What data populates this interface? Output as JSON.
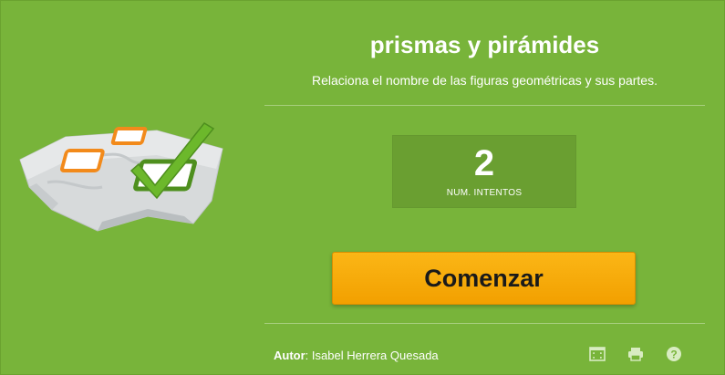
{
  "header": {
    "title": "prismas y pirámides",
    "subtitle": "Relaciona el nombre de las figuras geométricas y sus partes."
  },
  "attempts": {
    "value": "2",
    "label": "NUM. INTENTOS"
  },
  "start_button": {
    "label": "Comenzar"
  },
  "footer": {
    "author_label": "Autor",
    "author_separator": ":",
    "author_name": " Isabel Herrera Quesada",
    "icons": [
      "fullscreen-icon",
      "print-icon",
      "help-icon"
    ]
  },
  "colors": {
    "background": "#78b43a",
    "panel": "#6a9f31",
    "button": "#f7ab08",
    "check": "#6cb82b",
    "tile_orange": "#f28a1b"
  }
}
